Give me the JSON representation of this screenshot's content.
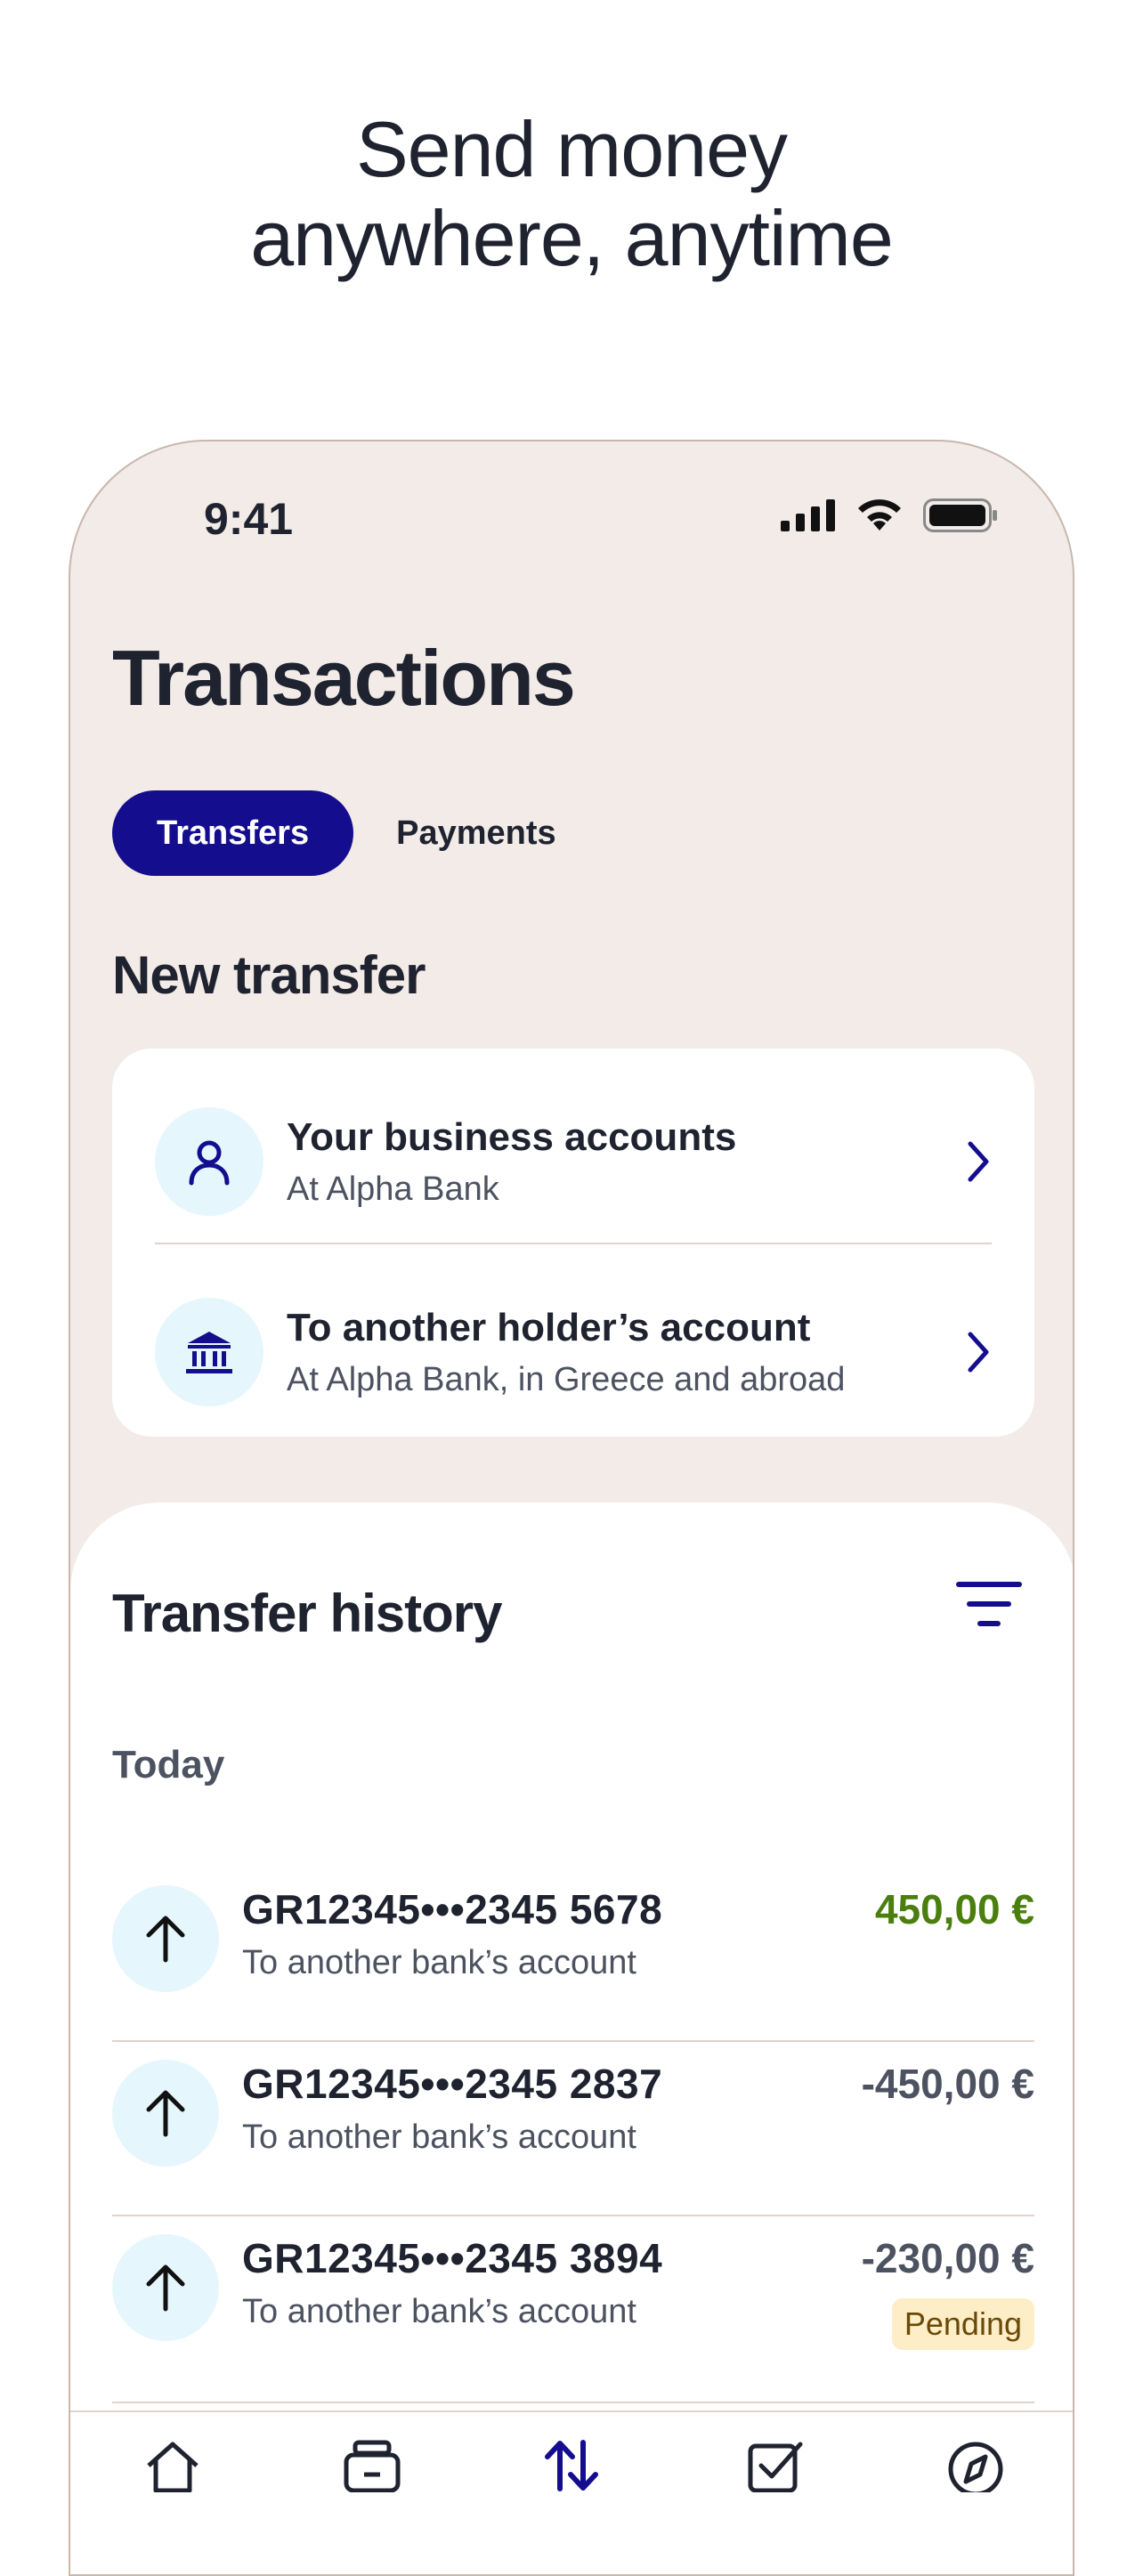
{
  "headline": {
    "line1": "Send money",
    "line2": "anywhere, anytime"
  },
  "status_bar": {
    "time": "9:41",
    "icons": [
      "signal-icon",
      "wifi-icon",
      "battery-icon"
    ]
  },
  "page": {
    "title": "Transactions"
  },
  "tabs": [
    {
      "label": "Transfers",
      "active": true
    },
    {
      "label": "Payments",
      "active": false
    }
  ],
  "new_transfer": {
    "title": "New transfer",
    "options": [
      {
        "title": "Your business accounts",
        "subtitle": "At Alpha Bank",
        "icon": "person-icon"
      },
      {
        "title": "To another holder’s account",
        "subtitle": "At Alpha Bank, in Greece and abroad",
        "icon": "bank-icon"
      }
    ]
  },
  "history": {
    "title": "Transfer history",
    "group_label": "Today",
    "transactions": [
      {
        "iban": "GR12345•••2345 5678",
        "description": "To another bank’s account",
        "amount": "450,00 €",
        "direction": "positive",
        "status": ""
      },
      {
        "iban": "GR12345•••2345 2837",
        "description": "To another bank’s account",
        "amount": "-450,00 €",
        "direction": "negative",
        "status": ""
      },
      {
        "iban": "GR12345•••2345 3894",
        "description": "To another bank’s account",
        "amount": "-230,00 €",
        "direction": "negative",
        "status": "Pending"
      }
    ]
  },
  "bottom_nav": {
    "items": [
      "home-icon",
      "wallet-icon",
      "transfers-icon",
      "tasks-icon",
      "explore-icon"
    ],
    "active": "transfers-icon"
  },
  "colors": {
    "brand": "#140e8f",
    "phone_bg": "#f2ebe7",
    "icon_circle": "#e6f6fd",
    "positive": "#4a7f0e",
    "pending_bg": "#fdeec8"
  }
}
